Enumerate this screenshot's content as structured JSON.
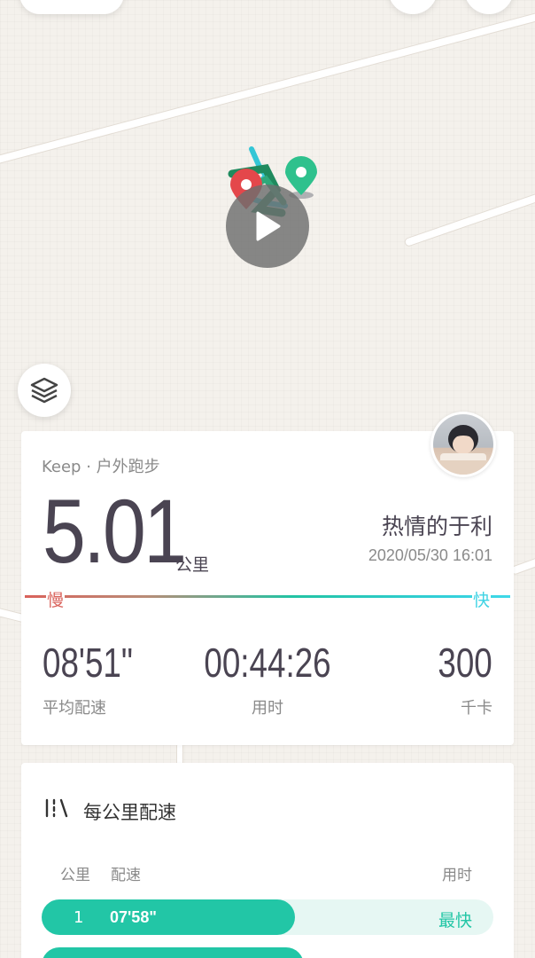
{
  "app": {
    "name": "Keep"
  },
  "summary": {
    "source": "Keep · 户外跑步",
    "distance": "5.01",
    "distance_unit": "公里",
    "username": "热情的于利",
    "datetime": "2020/05/30 16:01"
  },
  "speed_scale": {
    "slow": "慢",
    "fast": "快"
  },
  "stats": {
    "avg_pace": {
      "value": "08'51\"",
      "label": "平均配速"
    },
    "duration": {
      "value": "00:44:26",
      "label": "用时"
    },
    "calories": {
      "value": "300",
      "label": "千卡"
    }
  },
  "pace_section": {
    "title": "每公里配速",
    "col_km": "公里",
    "col_pace": "配速",
    "col_time": "用时",
    "rows": [
      {
        "km": "1",
        "pace": "07'58\"",
        "badge": "最快",
        "fraction": 0.56
      },
      {
        "km": "",
        "pace": "",
        "badge": "",
        "fraction": 0.58
      }
    ]
  },
  "colors": {
    "slow": "#d9625b",
    "fast": "#3fd8e8",
    "accent": "#22c6a6",
    "start_marker": "#2ec18d",
    "end_marker": "#e4474b"
  },
  "icons": {
    "play": "play-icon",
    "layers": "layers-icon",
    "start_pin": "map-pin-icon",
    "end_pin": "map-pin-icon",
    "pace": "pace-chart-icon"
  }
}
